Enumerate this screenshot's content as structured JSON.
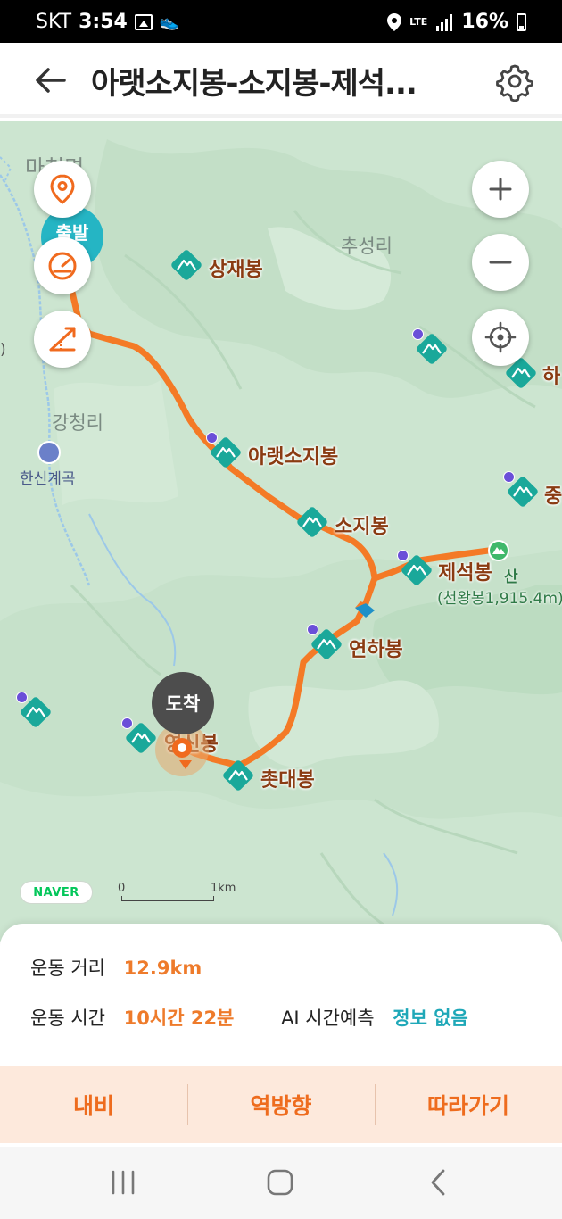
{
  "status_bar": {
    "carrier": "SKT",
    "time": "3:54",
    "network": "LTE",
    "battery": "16%"
  },
  "header": {
    "title": "아랫소지봉-소지봉-제석..."
  },
  "map": {
    "villages": {
      "machon": "마천면",
      "chuseong": "추성리",
      "gangcheong": "강청리"
    },
    "valley": "한신계곡",
    "peaks": {
      "sangjae": "상재봉",
      "araet_soji": "아랫소지봉",
      "soji": "소지봉",
      "jeseok": "제석봉",
      "yeonha": "연하봉",
      "chotdae": "촛대봉",
      "yeongsin_partial": "영신봉",
      "ha_partial": "하",
      "jung_partial": "중"
    },
    "summit_suffix": "산",
    "summit_detail": "(천왕봉1,915.4m)",
    "start_label": "출발",
    "arrive_label": "도착",
    "naver": "NAVER",
    "scale_start": "0",
    "scale_end": "1km",
    "route_color": "#f47a26",
    "peak_color": "#1aa89a"
  },
  "stats": {
    "distance_label": "운동 거리",
    "distance_value": "12.9km",
    "time_label": "운동 시간",
    "time_value": "10시간 22분",
    "ai_label": "AI 시간예측",
    "ai_value": "정보 없음"
  },
  "actions": {
    "navi": "내비",
    "reverse": "역방향",
    "follow": "따라가기"
  },
  "icons": [
    "back-arrow-icon",
    "settings-gear-icon",
    "location-pin-icon",
    "speedometer-icon",
    "elevation-icon",
    "zoom-in-icon",
    "zoom-out-icon",
    "my-location-icon"
  ]
}
